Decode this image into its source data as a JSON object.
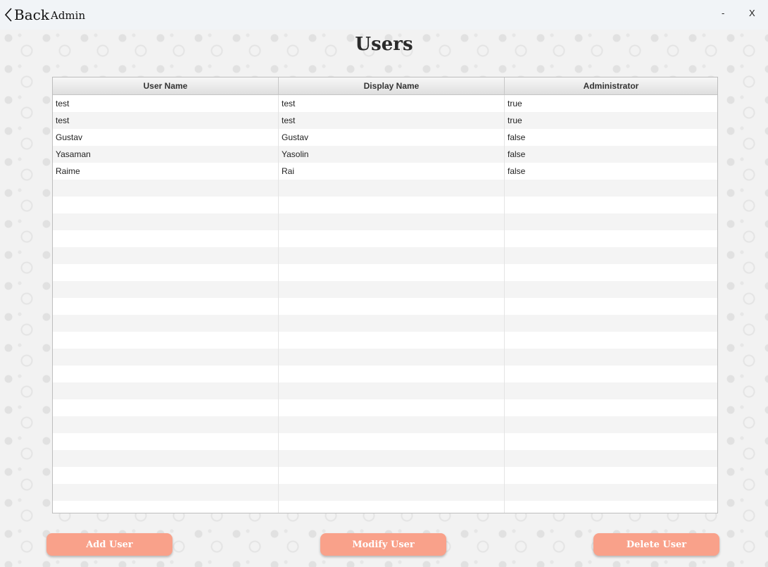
{
  "titlebar": {
    "back_label": "Back",
    "app_title": "Admin",
    "minimize_label": "-",
    "close_label": "X"
  },
  "page": {
    "title": "Users"
  },
  "table": {
    "columns": [
      "User Name",
      "Display Name",
      "Administrator"
    ],
    "rows": [
      [
        "test",
        "test",
        "true"
      ],
      [
        "test",
        "test",
        "true"
      ],
      [
        "Gustav",
        "Gustav",
        "false"
      ],
      [
        "Yasaman",
        "Yasolin",
        "false"
      ],
      [
        "Raime",
        "Rai",
        "false"
      ]
    ],
    "empty_rows": 20
  },
  "actions": {
    "add_label": "Add User",
    "modify_label": "Modify User",
    "delete_label": "Delete User"
  },
  "colors": {
    "button": "#f9a18a",
    "titlebar": "#f1f4f7"
  },
  "icons": {
    "back": "chevron-left-icon"
  }
}
